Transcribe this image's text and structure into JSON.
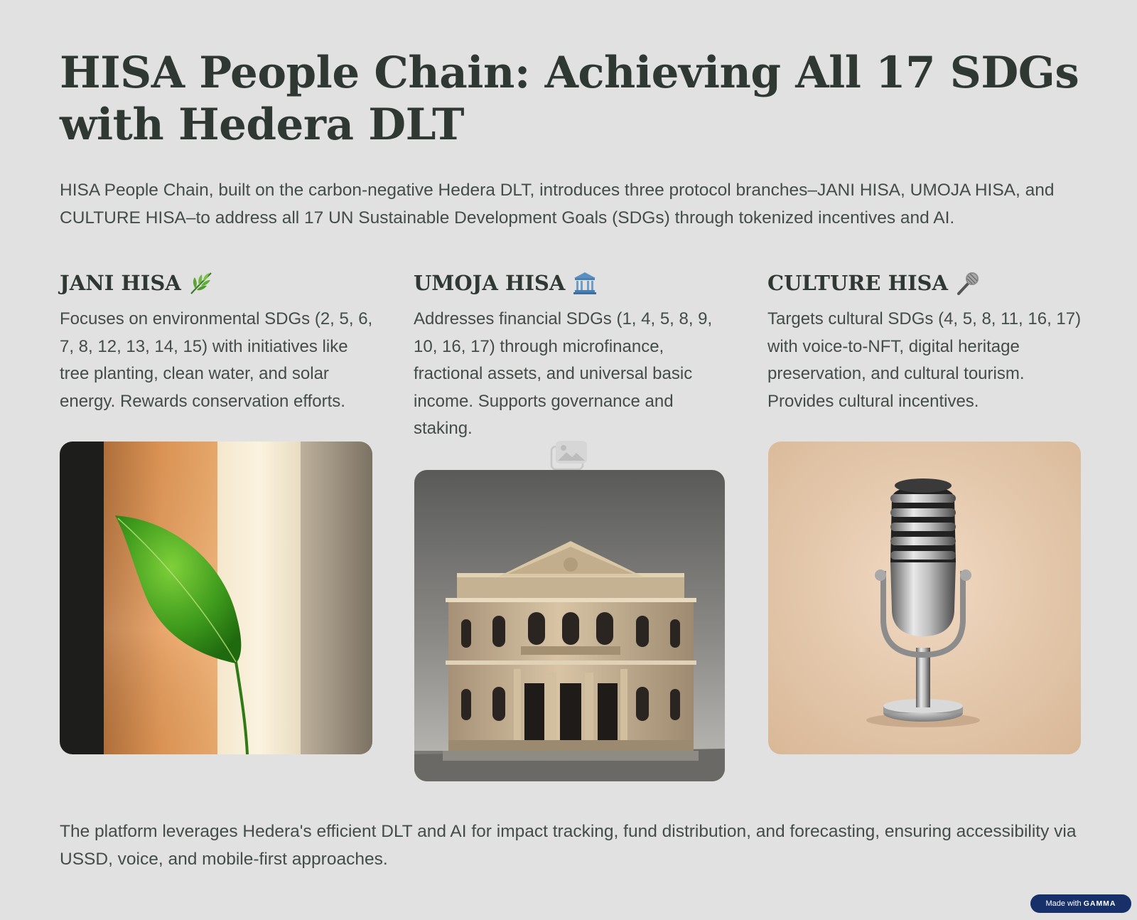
{
  "header": {
    "title": "HISA People Chain: Achieving All 17 SDGs with Hedera DLT"
  },
  "intro": {
    "text": "HISA People Chain, built on the carbon-negative Hedera DLT, introduces three protocol branches–JANI HISA, UMOJA HISA, and CULTURE HISA–to address all 17 UN Sustainable Development Goals (SDGs) through tokenized incentives and AI."
  },
  "columns": [
    {
      "title": "JANI HISA",
      "icon": "leaf-icon",
      "text": "Focuses on environmental SDGs (2, 5, 6, 7, 8, 12, 13, 14, 15) with initiatives like tree planting, clean water, and solar energy. Rewards conservation efforts.",
      "image": "leaf-photo"
    },
    {
      "title": "UMOJA HISA",
      "icon": "classical-building-icon",
      "text": "Addresses financial SDGs (1, 4, 5, 8, 9, 10, 16, 17) through microfinance, fractional assets, and universal basic income. Supports governance and staking.",
      "image": "bank-building-photo"
    },
    {
      "title": "CULTURE HISA",
      "icon": "microphone-icon",
      "text": "Targets cultural SDGs (4, 5, 8, 11, 16, 17) with voice-to-NFT, digital heritage preservation, and cultural tourism. Provides cultural incentives.",
      "image": "microphone-photo"
    }
  ],
  "outro": {
    "text": "The platform leverages Hedera's efficient DLT and AI for impact tracking, fund distribution, and forecasting, ensuring accessibility via USSD, voice, and mobile-first approaches."
  },
  "badge": {
    "prefix": "Made with",
    "brand": "GAMMA"
  },
  "colors": {
    "background": "#e1e1e1",
    "heading": "#2f3833",
    "body_text": "#444c47",
    "badge": "#17306a"
  }
}
